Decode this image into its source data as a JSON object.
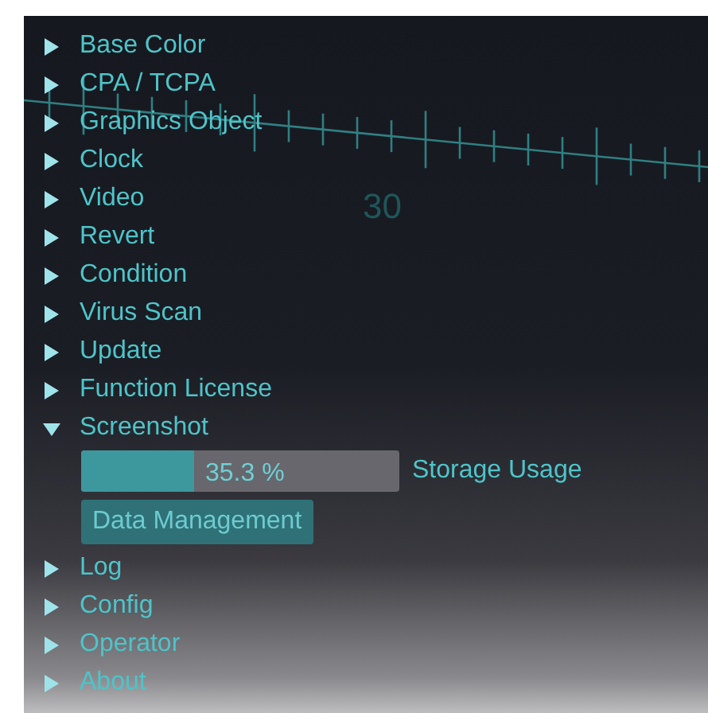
{
  "ruler": {
    "labels": [
      "30"
    ]
  },
  "menu": [
    {
      "label": "Base Color",
      "expanded": false
    },
    {
      "label": "CPA / TCPA",
      "expanded": false
    },
    {
      "label": "Graphics Object",
      "expanded": false
    },
    {
      "label": "Clock",
      "expanded": false
    },
    {
      "label": "Video",
      "expanded": false
    },
    {
      "label": "Revert",
      "expanded": false
    },
    {
      "label": "Condition",
      "expanded": false
    },
    {
      "label": "Virus Scan",
      "expanded": false
    },
    {
      "label": "Update",
      "expanded": false
    },
    {
      "label": "Function License",
      "expanded": false
    },
    {
      "label": "Screenshot",
      "expanded": true,
      "children": [
        {
          "kind": "meter",
          "level": 0.353,
          "reading": "35.3 %",
          "label": "Storage Usage"
        },
        {
          "kind": "button",
          "label": "Data Management"
        }
      ]
    },
    {
      "label": "Log",
      "expanded": false
    },
    {
      "label": "Config",
      "expanded": false
    },
    {
      "label": "Operator",
      "expanded": false
    },
    {
      "label": "About",
      "expanded": false
    }
  ]
}
